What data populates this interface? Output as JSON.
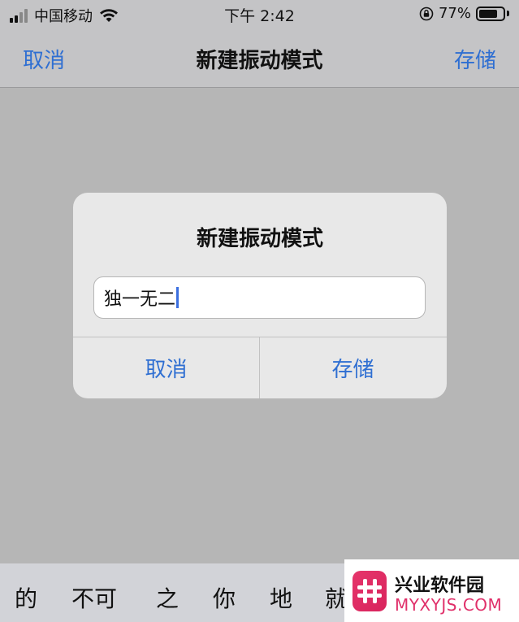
{
  "status_bar": {
    "carrier": "中国移动",
    "time": "下午 2:42",
    "battery_percent": "77%",
    "battery_level": 0.77,
    "signal_bars": 4
  },
  "nav": {
    "cancel_label": "取消",
    "title": "新建振动模式",
    "save_label": "存储"
  },
  "alert": {
    "title": "新建振动模式",
    "input_value": "独一无二",
    "cancel_label": "取消",
    "save_label": "存储"
  },
  "keyboard_suggestions": [
    "的",
    "不可",
    "之",
    "你",
    "地",
    "就"
  ],
  "watermark": {
    "name": "兴业软件园",
    "url": "MYXYJS.COM"
  },
  "colors": {
    "accent": "#2f6fd2",
    "watermark_pink": "#e0306a"
  }
}
